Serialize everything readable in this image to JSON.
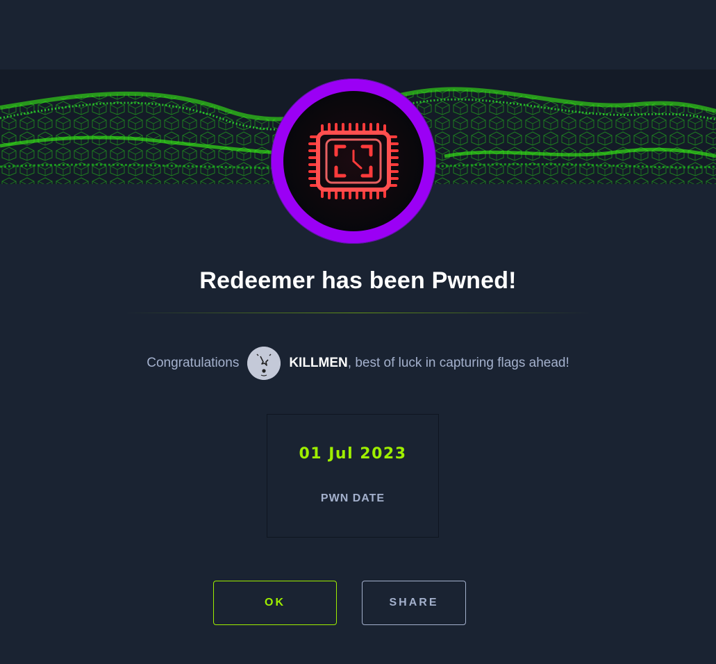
{
  "modal": {
    "machine_name": "Redeemer",
    "title": "Redeemer has been Pwned!",
    "congrats_prefix": "Congratulations",
    "username": "KILLMEN",
    "congrats_suffix": ", best of luck in capturing flags ahead!",
    "pwn_date": "01 Jul 2023",
    "pwn_date_label": "PWN DATE"
  },
  "buttons": {
    "ok_label": "OK",
    "share_label": "SHARE"
  },
  "colors": {
    "background": "#1a2332",
    "accent_green": "#9fef00",
    "badge_ring": "#9b00f5",
    "chip_red": "#ff3b3b",
    "muted_text": "#a4b1cd"
  },
  "icons": {
    "badge": "cpu-clock-icon",
    "avatar": "user-avatar"
  }
}
